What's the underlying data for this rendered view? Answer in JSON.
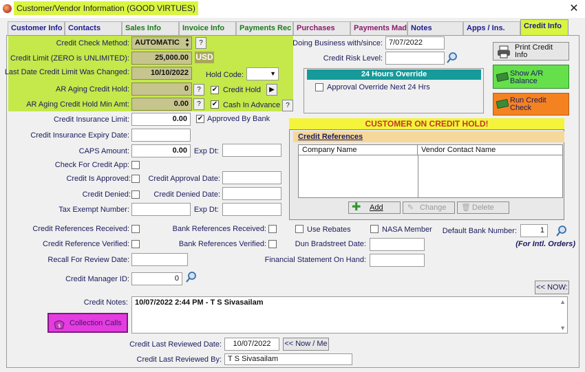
{
  "window": {
    "title": "Customer/Vendor Information  (GOOD VIRTUES)"
  },
  "tabs": [
    {
      "label": "Customer Info",
      "color": "#1a1a8e"
    },
    {
      "label": "Contacts",
      "color": "#1a1a8e"
    },
    {
      "label": "Sales Info",
      "color": "#1a7a1a"
    },
    {
      "label": "Invoice Info",
      "color": "#1a7a1a"
    },
    {
      "label": "Payments Rec",
      "color": "#1a7a1a"
    },
    {
      "label": "Purchases",
      "color": "#8a1a6a"
    },
    {
      "label": "Payments Made",
      "color": "#8a1a6a"
    },
    {
      "label": "Notes",
      "color": "#1a1a8e"
    },
    {
      "label": "Apps / Ins.",
      "color": "#1a1a8e"
    },
    {
      "label": "Credit Info",
      "color": "#1a1a8e"
    }
  ],
  "credit": {
    "check_method_label": "Credit Check Method:",
    "check_method_value": "AUTOMATIC",
    "limit_label": "Credit Limit (ZERO is UNLIMITED):",
    "limit_value": "25,000.00",
    "currency": "USD",
    "last_changed_label": "Last Date Credit Limit Was Changed:",
    "last_changed_value": "10/10/2022",
    "hold_code_label": "Hold Code:",
    "ar_aging_hold_label": "AR Aging Credit Hold:",
    "ar_aging_hold_value": "0",
    "ar_aging_min_label": "AR Aging Credit Hold Min Amt:",
    "ar_aging_min_value": "0.00",
    "credit_hold_label": "Credit Hold",
    "cash_in_advance_label": "Cash In Advance",
    "q": "?",
    "arrow": "▶"
  },
  "right": {
    "doing_business_label": "Doing Business with/since:",
    "doing_business_value": "7/07/2022",
    "risk_label": "Credit Risk Level:",
    "override_title": "24 Hours Override",
    "override_checkbox": "Approval Override Next 24 Hrs",
    "print_btn": "Print   Credit Info",
    "show_ar_btn": "Show A/R Balance",
    "run_credit_btn": "Run Credit Check"
  },
  "insurance": {
    "limit_label": "Credit Insurance Limit:",
    "limit_value": "0.00",
    "approved_by_bank": "Approved By Bank",
    "expiry_label": "Credit Insurance Expiry Date:",
    "caps_label": "CAPS Amount:",
    "caps_value": "0.00",
    "exp_dt_label": "Exp Dt:",
    "check_app_label": "Check For Credit App:",
    "is_approved_label": "Credit Is Approved:",
    "approval_date_label": "Credit Approval Date:",
    "denied_label": "Credit Denied:",
    "denied_date_label": "Credit Denied Date:",
    "tax_exempt_label": "Tax Exempt Number:",
    "exp_dt2_label": "Exp Dt:"
  },
  "hold_banner": "CUSTOMER ON CREDIT HOLD!",
  "credit_references": {
    "title": "Credit References",
    "columns": [
      "Company Name",
      "Vendor Contact Name"
    ],
    "add": "Add",
    "change": "Change",
    "delete": "Delete"
  },
  "refs": {
    "cr_received": "Credit References Received:",
    "bank_received": "Bank References Received:",
    "use_rebates": "Use Rebates",
    "nasa_member": "NASA Member",
    "default_bank_label": "Default Bank Number:",
    "default_bank_value": "1",
    "intl_orders": "(For Intl. Orders)",
    "cr_verified": "Credit Reference Verified:",
    "bank_verified": "Bank References Verified:",
    "dun_label": "Dun Bradstreet Date:",
    "recall_label": "Recall For Review Date:",
    "financial_label": "Financial Statement On Hand:",
    "manager_label": "Credit Manager ID:",
    "manager_value": "0",
    "now_btn": "<< NOW:"
  },
  "notes": {
    "label": "Credit Notes:",
    "value": "10/07/2022  2:44 PM - T S Sivasailam",
    "collection_btn": "Collection Calls"
  },
  "review": {
    "date_label": "Credit Last Reviewed Date:",
    "date_value": "10/07/2022",
    "now_me_btn": "<< Now / Me",
    "by_label": "Credit Last Reviewed By:",
    "by_value": "T S Sivasailam"
  }
}
